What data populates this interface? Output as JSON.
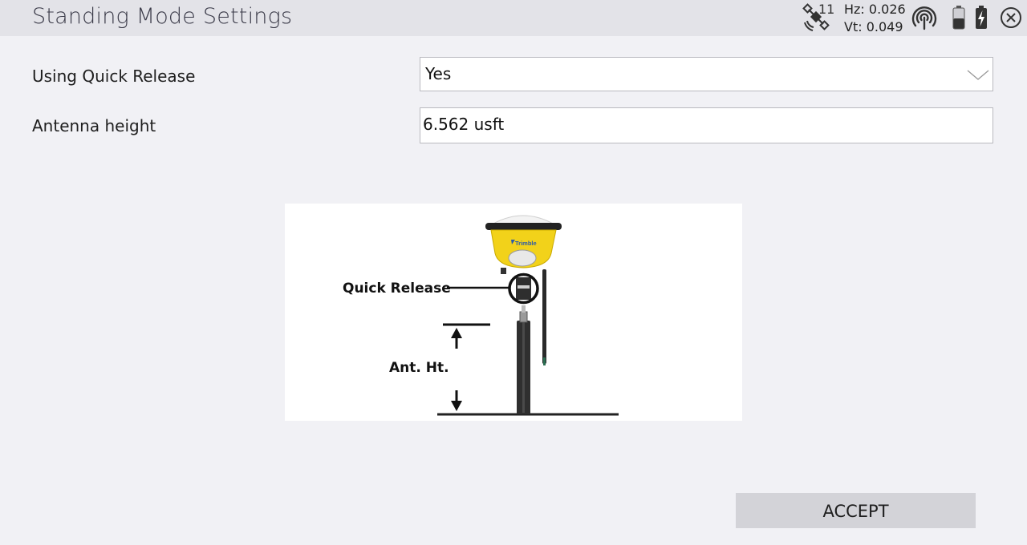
{
  "header": {
    "title": "Standing Mode Settings",
    "satellite_count": "11",
    "hz_precision": "Hz: 0.026",
    "vt_precision": "Vt: 0.049",
    "icons": [
      "satellite-icon",
      "radio-signal-icon",
      "battery-icon",
      "battery-charging-icon",
      "close-icon"
    ]
  },
  "form": {
    "quick_release": {
      "label": "Using Quick Release",
      "value": "Yes"
    },
    "antenna_height": {
      "label": "Antenna height",
      "value": "6.562 usft"
    }
  },
  "diagram": {
    "brand": "Trimble",
    "quick_release_label": "Quick Release",
    "ant_ht_label": "Ant. Ht."
  },
  "footer": {
    "accept_label": "ACCEPT"
  },
  "colors": {
    "titlebar_bg": "#e3e3e8",
    "page_bg": "#f1f1f5",
    "receiver_yellow": "#f2d21a",
    "button_bg": "#d3d3d8"
  }
}
